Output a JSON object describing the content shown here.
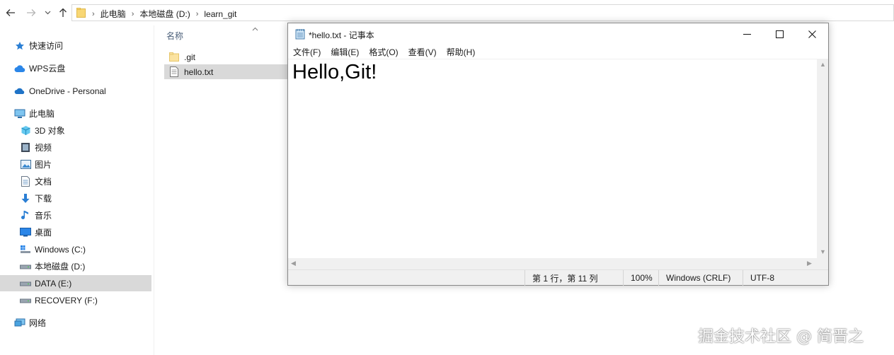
{
  "address_bar": {
    "breadcrumbs": [
      "此电脑",
      "本地磁盘 (D:)",
      "learn_git"
    ]
  },
  "sidebar": {
    "items": [
      {
        "label": "快速访问",
        "icon": "star-icon"
      },
      {
        "label": "WPS云盘",
        "icon": "cloud-icon"
      },
      {
        "label": "OneDrive - Personal",
        "icon": "onedrive-icon"
      },
      {
        "label": "此电脑",
        "icon": "computer-icon"
      },
      {
        "label": "3D 对象",
        "icon": "cube-icon"
      },
      {
        "label": "视频",
        "icon": "video-icon"
      },
      {
        "label": "图片",
        "icon": "picture-icon"
      },
      {
        "label": "文档",
        "icon": "document-icon"
      },
      {
        "label": "下载",
        "icon": "download-icon"
      },
      {
        "label": "音乐",
        "icon": "music-icon"
      },
      {
        "label": "桌面",
        "icon": "desktop-icon"
      },
      {
        "label": "Windows (C:)",
        "icon": "windows-drive-icon"
      },
      {
        "label": "本地磁盘 (D:)",
        "icon": "drive-icon"
      },
      {
        "label": "DATA (E:)",
        "icon": "drive-icon"
      },
      {
        "label": "RECOVERY (F:)",
        "icon": "drive-icon"
      },
      {
        "label": "网络",
        "icon": "network-icon"
      }
    ]
  },
  "file_list": {
    "column_header": "名称",
    "files": [
      {
        "name": ".git",
        "icon": "folder-icon"
      },
      {
        "name": "hello.txt",
        "icon": "text-file-icon"
      }
    ]
  },
  "notepad": {
    "title": "*hello.txt - 记事本",
    "menu": [
      "文件(F)",
      "编辑(E)",
      "格式(O)",
      "查看(V)",
      "帮助(H)"
    ],
    "content": "Hello,Git!",
    "status": {
      "position": "第 1 行，第 11 列",
      "zoom": "100%",
      "line_ending": "Windows (CRLF)",
      "encoding": "UTF-8"
    }
  },
  "watermark": "掘金技术社区 @ 简晋之",
  "colors": {
    "selection": "#d9d9d9",
    "folder": "#f8d775",
    "header_text": "#4c607a"
  }
}
